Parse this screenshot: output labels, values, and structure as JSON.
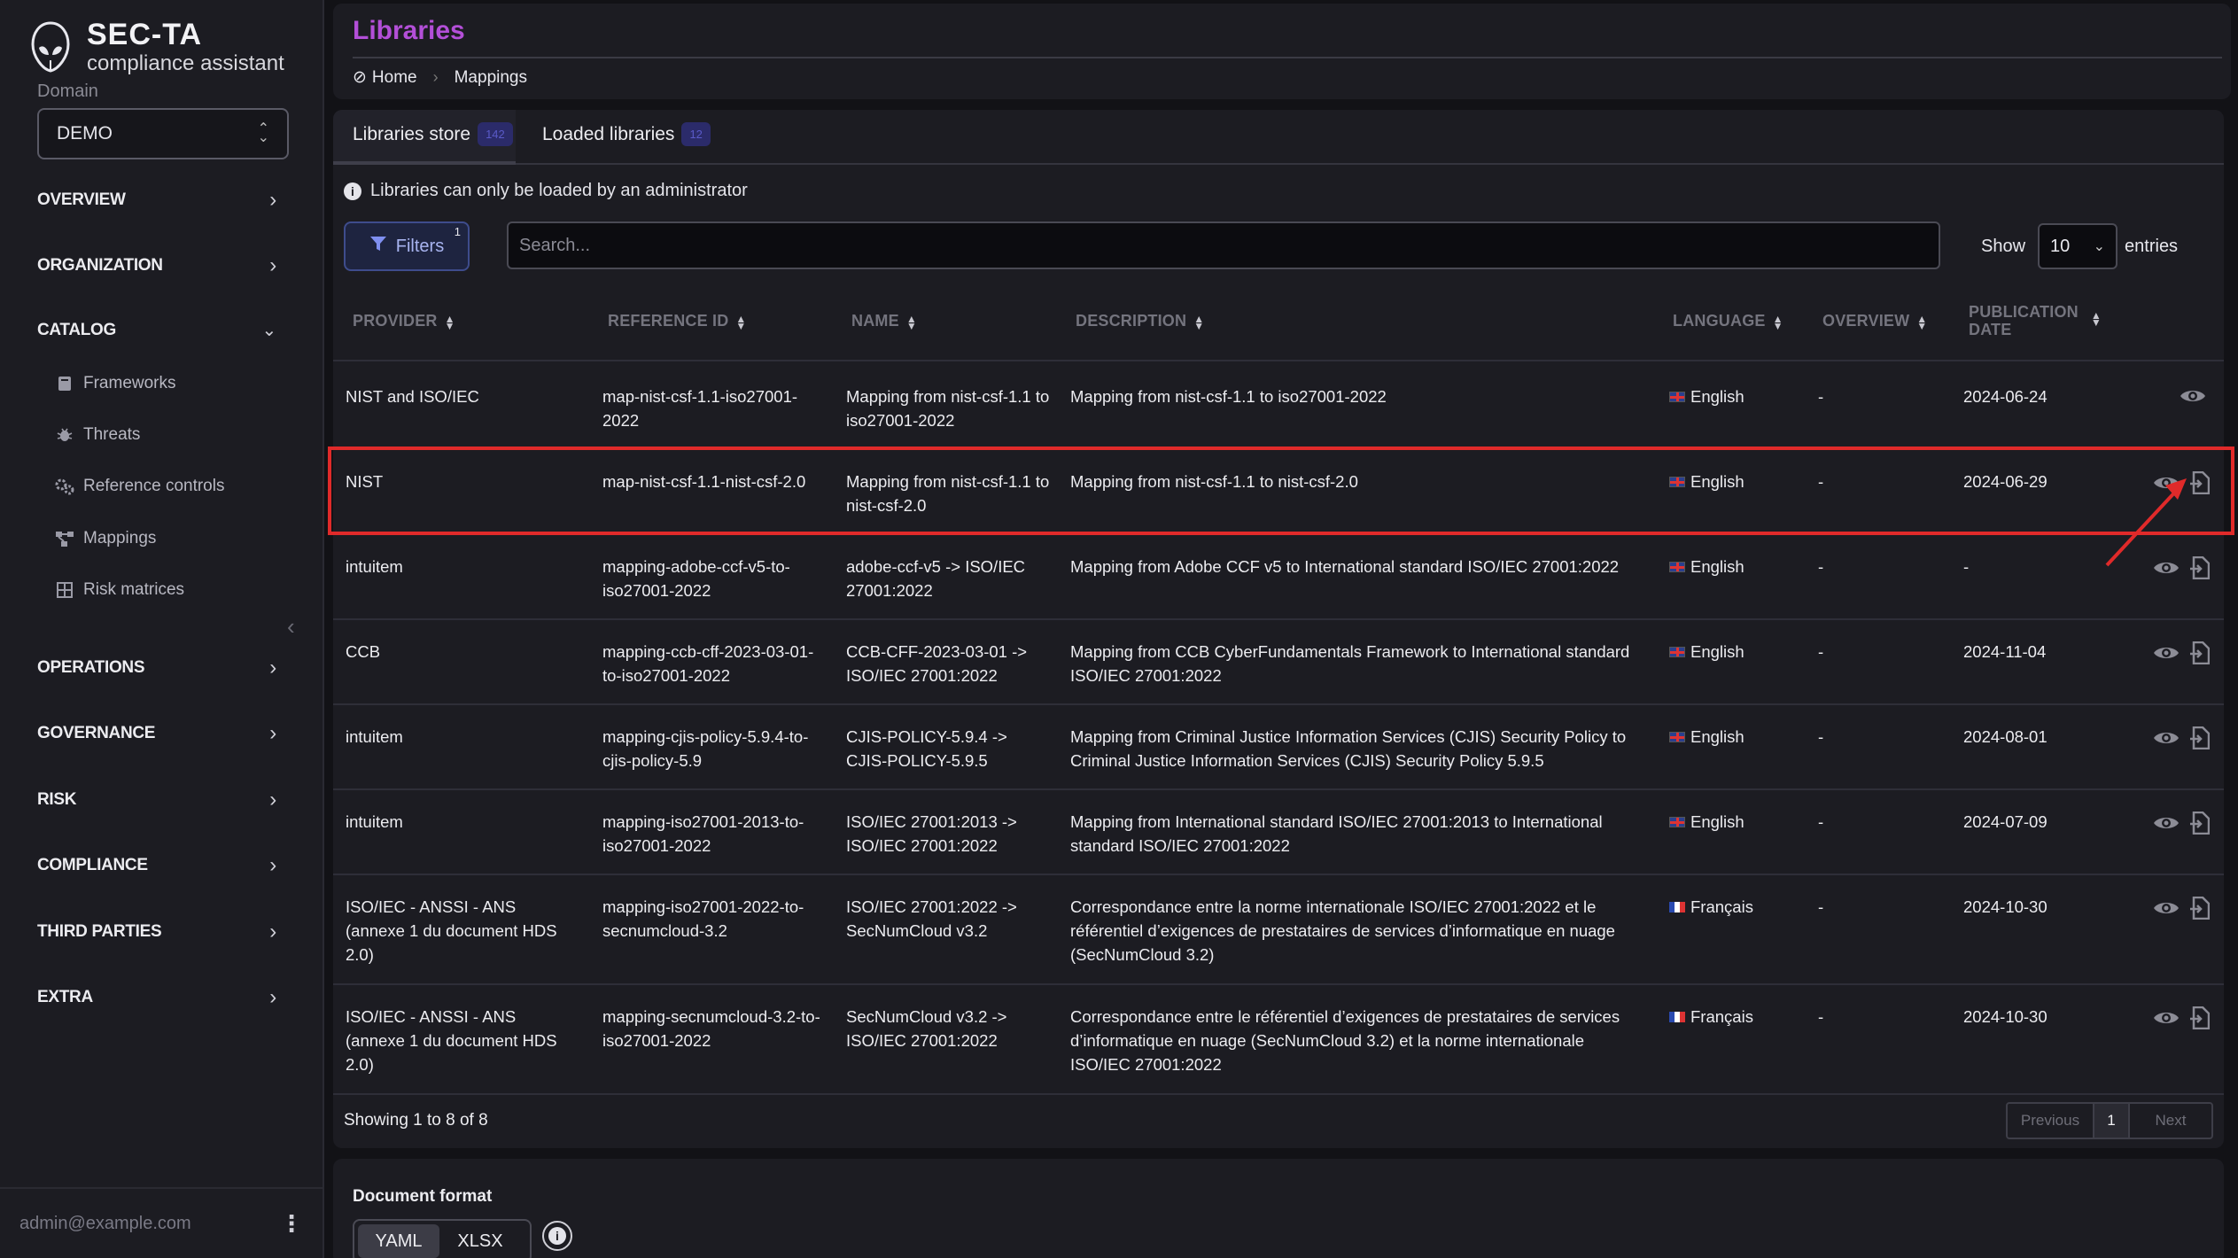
{
  "app": {
    "logo_title": "SEC-TA",
    "logo_subtitle": "compliance assistant",
    "domain_label": "Domain",
    "domain_value": "DEMO",
    "user_email": "admin@example.com"
  },
  "sidebar": {
    "sections": [
      {
        "label": "OVERVIEW",
        "expanded": false
      },
      {
        "label": "ORGANIZATION",
        "expanded": false
      },
      {
        "label": "CATALOG",
        "expanded": true
      },
      {
        "label": "OPERATIONS",
        "expanded": false
      },
      {
        "label": "GOVERNANCE",
        "expanded": false
      },
      {
        "label": "RISK",
        "expanded": false
      },
      {
        "label": "COMPLIANCE",
        "expanded": false
      },
      {
        "label": "THIRD PARTIES",
        "expanded": false
      },
      {
        "label": "EXTRA",
        "expanded": false
      }
    ],
    "catalog_items": [
      {
        "label": "Frameworks",
        "icon": "book-icon"
      },
      {
        "label": "Threats",
        "icon": "bug-icon"
      },
      {
        "label": "Reference controls",
        "icon": "gears-icon"
      },
      {
        "label": "Mappings",
        "icon": "diagram-icon"
      },
      {
        "label": "Risk matrices",
        "icon": "grid-icon"
      }
    ]
  },
  "header": {
    "title": "Libraries",
    "breadcrumb": [
      "Home",
      "Mappings"
    ]
  },
  "tabs": [
    {
      "label": "Libraries store",
      "badge": "142",
      "active": true
    },
    {
      "label": "Loaded libraries",
      "badge": "12",
      "active": false
    }
  ],
  "notice": "Libraries can only be loaded by an administrator",
  "filters": {
    "label": "Filters",
    "count": "1"
  },
  "search": {
    "placeholder": "Search...",
    "value": ""
  },
  "page_size": {
    "before": "Show",
    "value": "10",
    "after": "entries"
  },
  "table": {
    "columns": [
      "PROVIDER",
      "REFERENCE ID",
      "NAME",
      "DESCRIPTION",
      "LANGUAGE",
      "OVERVIEW",
      "PUBLICATION DATE"
    ],
    "rows": [
      {
        "provider": "NIST and ISO/IEC",
        "ref": "map-nist-csf-1.1-iso27001-2022",
        "name": "Mapping from nist-csf-1.1 to iso27001-2022",
        "desc": "Mapping from nist-csf-1.1 to iso27001-2022",
        "lang": "English",
        "flag": "uk",
        "overview": "-",
        "date": "2024-06-24",
        "loadable": false
      },
      {
        "provider": "NIST",
        "ref": "map-nist-csf-1.1-nist-csf-2.0",
        "name": "Mapping from nist-csf-1.1 to nist-csf-2.0",
        "desc": "Mapping from nist-csf-1.1 to nist-csf-2.0",
        "lang": "English",
        "flag": "uk",
        "overview": "-",
        "date": "2024-06-29",
        "loadable": true
      },
      {
        "provider": "intuitem",
        "ref": "mapping-adobe-ccf-v5-to-iso27001-2022",
        "name": "adobe-ccf-v5 -> ISO/IEC 27001:2022",
        "desc": "Mapping from Adobe CCF v5 to International standard ISO/IEC 27001:2022",
        "lang": "English",
        "flag": "uk",
        "overview": "-",
        "date": "-",
        "loadable": true
      },
      {
        "provider": "CCB",
        "ref": "mapping-ccb-cff-2023-03-01-to-iso27001-2022",
        "name": "CCB-CFF-2023-03-01 -> ISO/IEC 27001:2022",
        "desc": "Mapping from CCB CyberFundamentals Framework to International standard ISO/IEC 27001:2022",
        "lang": "English",
        "flag": "uk",
        "overview": "-",
        "date": "2024-11-04",
        "loadable": true
      },
      {
        "provider": "intuitem",
        "ref": "mapping-cjis-policy-5.9.4-to-cjis-policy-5.9",
        "name": "CJIS-POLICY-5.9.4 -> CJIS-POLICY-5.9.5",
        "desc": "Mapping from Criminal Justice Information Services (CJIS) Security Policy to Criminal Justice Information Services (CJIS) Security Policy 5.9.5",
        "lang": "English",
        "flag": "uk",
        "overview": "-",
        "date": "2024-08-01",
        "loadable": true
      },
      {
        "provider": "intuitem",
        "ref": "mapping-iso27001-2013-to-iso27001-2022",
        "name": "ISO/IEC 27001:2013 -> ISO/IEC 27001:2022",
        "desc": "Mapping from International standard ISO/IEC 27001:2013 to International standard ISO/IEC 27001:2022",
        "lang": "English",
        "flag": "uk",
        "overview": "-",
        "date": "2024-07-09",
        "loadable": true
      },
      {
        "provider": "ISO/IEC - ANSSI - ANS (annexe 1 du document HDS 2.0)",
        "ref": "mapping-iso27001-2022-to-secnumcloud-3.2",
        "name": "ISO/IEC 27001:2022 -> SecNumCloud v3.2",
        "desc": "Correspondance entre la norme internationale ISO/IEC 27001:2022 et le référentiel d’exigences de prestataires de services d’informatique en nuage (SecNumCloud 3.2)",
        "lang": "Français",
        "flag": "fr",
        "overview": "-",
        "date": "2024-10-30",
        "loadable": true
      },
      {
        "provider": "ISO/IEC - ANSSI - ANS (annexe 1 du document HDS 2.0)",
        "ref": "mapping-secnumcloud-3.2-to-iso27001-2022",
        "name": "SecNumCloud v3.2 -> ISO/IEC 27001:2022",
        "desc": "Correspondance entre le référentiel d’exigences de prestataires de services d’informatique en nuage (SecNumCloud 3.2) et la norme internationale ISO/IEC 27001:2022",
        "lang": "Français",
        "flag": "fr",
        "overview": "-",
        "date": "2024-10-30",
        "loadable": true
      }
    ]
  },
  "pagination": {
    "summary": "Showing 1 to 8 of 8",
    "previous": "Previous",
    "current": "1",
    "next": "Next"
  },
  "document_format": {
    "label": "Document format",
    "options": [
      "YAML",
      "XLSX"
    ],
    "selected": "YAML"
  },
  "colors": {
    "accent": "#b34fd8",
    "highlight": "#e02a2a",
    "filter_accent": "#7f8ff0"
  }
}
